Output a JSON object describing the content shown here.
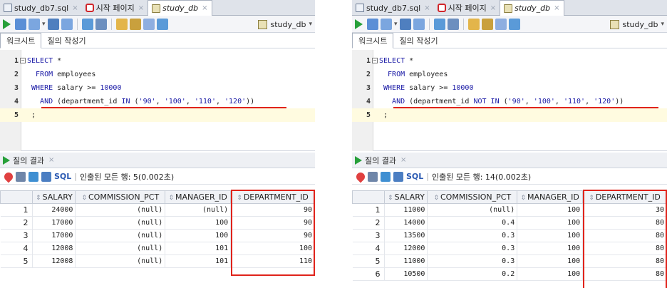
{
  "colors": {
    "highlight_red": "#e0231b",
    "keyword_blue": "#1a1aa6",
    "run_green": "#27a03a"
  },
  "panels": [
    {
      "doc_tabs": [
        {
          "label": "study_db7.sql",
          "icon": "sql-file-icon"
        },
        {
          "label": "시작 페이지",
          "icon": "start-page-icon"
        },
        {
          "label": "study_db",
          "icon": "db-connection-icon",
          "active": true
        }
      ],
      "connection": "study_db",
      "worksheet_tabs": [
        "워크시트",
        "질의 작성기"
      ],
      "code_lines": [
        {
          "num": "1",
          "html_segments": [
            [
              "kw",
              "SELECT "
            ],
            [
              "id",
              "*"
            ]
          ]
        },
        {
          "num": "2",
          "html_segments": [
            [
              "kw",
              "  FROM "
            ],
            [
              "id",
              "employees"
            ]
          ]
        },
        {
          "num": "3",
          "html_segments": [
            [
              "kw",
              " WHERE "
            ],
            [
              "id",
              "salary >= "
            ],
            [
              "num",
              "10000"
            ]
          ]
        },
        {
          "num": "4",
          "html_segments": [
            [
              "kw",
              "   AND "
            ],
            [
              "id",
              "(department_id "
            ],
            [
              "kw",
              "IN "
            ],
            [
              "id",
              "("
            ],
            [
              "str",
              "'90'"
            ],
            [
              "id",
              ", "
            ],
            [
              "str",
              "'100'"
            ],
            [
              "id",
              ", "
            ],
            [
              "str",
              "'110'"
            ],
            [
              "id",
              ", "
            ],
            [
              "str",
              "'120'"
            ],
            [
              "id",
              "))"
            ]
          ]
        },
        {
          "num": "5",
          "html_segments": [
            [
              "id",
              " ;"
            ]
          ]
        }
      ],
      "results_tab": "질의 결과",
      "sql_label": "SQL",
      "status": "인출된 모든 행: 5(0.002초)",
      "columns": [
        "SALARY",
        "COMMISSION_PCT",
        "MANAGER_ID",
        "DEPARTMENT_ID"
      ],
      "rows": [
        [
          "1",
          "24000",
          "(null)",
          "(null)",
          "90"
        ],
        [
          "2",
          "17000",
          "(null)",
          "100",
          "90"
        ],
        [
          "3",
          "17000",
          "(null)",
          "100",
          "90"
        ],
        [
          "4",
          "12008",
          "(null)",
          "101",
          "100"
        ],
        [
          "5",
          "12008",
          "(null)",
          "101",
          "110"
        ]
      ]
    },
    {
      "doc_tabs": [
        {
          "label": "study_db7.sql",
          "icon": "sql-file-icon"
        },
        {
          "label": "시작 페이지",
          "icon": "start-page-icon"
        },
        {
          "label": "study_db",
          "icon": "db-connection-icon",
          "active": true
        }
      ],
      "connection": "study_db",
      "worksheet_tabs": [
        "워크시트",
        "질의 작성기"
      ],
      "code_lines": [
        {
          "num": "1",
          "html_segments": [
            [
              "kw",
              "SELECT "
            ],
            [
              "id",
              "*"
            ]
          ]
        },
        {
          "num": "2",
          "html_segments": [
            [
              "kw",
              "  FROM "
            ],
            [
              "id",
              "employees"
            ]
          ]
        },
        {
          "num": "3",
          "html_segments": [
            [
              "kw",
              " WHERE "
            ],
            [
              "id",
              "salary >= "
            ],
            [
              "num",
              "10000"
            ]
          ]
        },
        {
          "num": "4",
          "html_segments": [
            [
              "kw",
              "   AND "
            ],
            [
              "id",
              "(department_id "
            ],
            [
              "kw",
              "NOT IN "
            ],
            [
              "id",
              "("
            ],
            [
              "str",
              "'90'"
            ],
            [
              "id",
              ", "
            ],
            [
              "str",
              "'100'"
            ],
            [
              "id",
              ", "
            ],
            [
              "str",
              "'110'"
            ],
            [
              "id",
              ", "
            ],
            [
              "str",
              "'120'"
            ],
            [
              "id",
              "))"
            ]
          ]
        },
        {
          "num": "5",
          "html_segments": [
            [
              "id",
              " ;"
            ]
          ]
        }
      ],
      "results_tab": "질의 결과",
      "sql_label": "SQL",
      "status": "인출된 모든 행: 14(0.002초)",
      "columns": [
        "SALARY",
        "COMMISSION_PCT",
        "MANAGER_ID",
        "DEPARTMENT_ID"
      ],
      "rows": [
        [
          "1",
          "11000",
          "(null)",
          "100",
          "30"
        ],
        [
          "2",
          "14000",
          "0.4",
          "100",
          "80"
        ],
        [
          "3",
          "13500",
          "0.3",
          "100",
          "80"
        ],
        [
          "4",
          "12000",
          "0.3",
          "100",
          "80"
        ],
        [
          "5",
          "11000",
          "0.3",
          "100",
          "80"
        ],
        [
          "6",
          "10500",
          "0.2",
          "100",
          "80"
        ]
      ]
    }
  ]
}
